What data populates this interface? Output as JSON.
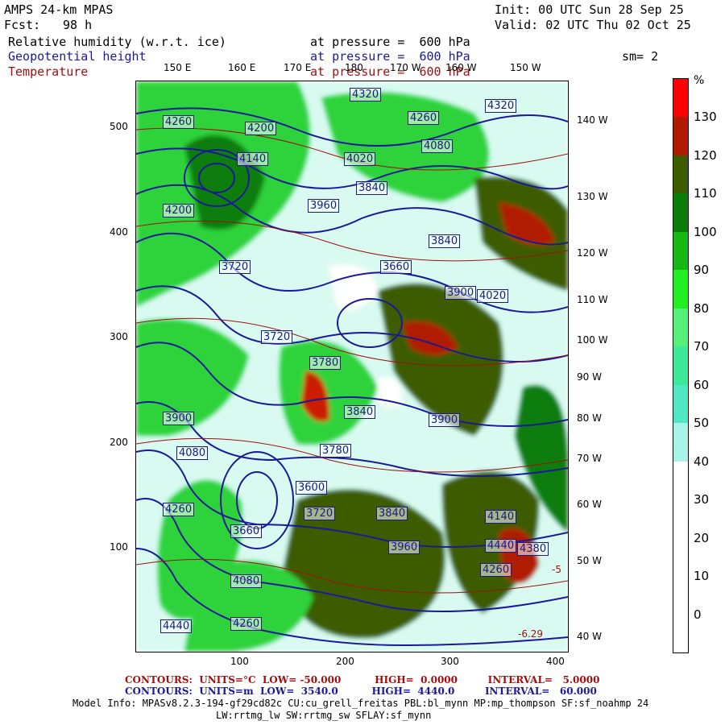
{
  "header": {
    "model": "AMPS 24-km MPAS",
    "fcst_label": "Fcst:",
    "fcst_value": "98 h",
    "init": "Init: 00 UTC Sun 28 Sep 25",
    "valid": "Valid: 02 UTC Thu 02 Oct 25",
    "smooth": "sm= 2"
  },
  "fields": [
    {
      "name": "Relative humidity (w.r.t. ice)",
      "level": "at pressure =  600 hPa",
      "color": "#000000"
    },
    {
      "name": "Geopotential height",
      "level": "at pressure =  600 hPa",
      "color": "#1a1a99"
    },
    {
      "name": "Temperature",
      "level": "at pressure =  600 hPa",
      "color": "#a01010"
    }
  ],
  "top_longitudes": [
    "150 E",
    "160 E",
    "170 E",
    "180",
    "170 W",
    "160 W",
    "150 W"
  ],
  "right_longitudes": [
    "140 W",
    "130 W",
    "120 W",
    "110 W",
    "100 W",
    "90 W",
    "80 W",
    "70 W",
    "60 W",
    "50 W",
    "40 W"
  ],
  "y_axis_ticks": [
    "500",
    "400",
    "300",
    "200",
    "100"
  ],
  "x_axis_ticks": [
    "100",
    "200",
    "300",
    "400"
  ],
  "colorbar": {
    "unit": "%",
    "labels": [
      "130",
      "120",
      "110",
      "100",
      "90",
      "80",
      "70",
      "60",
      "50",
      "40",
      "30",
      "20",
      "10",
      "0"
    ],
    "colors": [
      "#ff0000",
      "#b01a00",
      "#3d5c00",
      "#0a7d0a",
      "#16b816",
      "#22ee22",
      "#55f07a",
      "#3ee89a",
      "#50e8c4",
      "#a8f4e8",
      "#ffffff",
      "#ffffff",
      "#ffffff",
      "#ffffff",
      "#ffffff"
    ]
  },
  "contour_labels": [
    "4320",
    "4320",
    "4260",
    "4260",
    "4140",
    "4200",
    "4080",
    "4020",
    "3960",
    "3840",
    "3780",
    "3720",
    "3900",
    "4020",
    "3660",
    "3720",
    "3840",
    "3900",
    "4080",
    "4200",
    "4260",
    "4440",
    "4260",
    "4140",
    "4380",
    "4440",
    "4080",
    "4260",
    "3840",
    "3960",
    "3660",
    "3720",
    "3600",
    "3780",
    "3840",
    "3900"
  ],
  "footer": {
    "line1": "CONTOURS:  UNITS=°C  LOW= -50.000          HIGH=  0.0000         INTERVAL=   5.0000",
    "line2": "CONTOURS:  UNITS=m  LOW=  3540.0          HIGH=  4440.0         INTERVAL=   60.000",
    "line3": "Model Info: MPASv8.2.3-194-gf29cd82c CU:cu_grell_freitas PBL:bl_mynn MP:mp_thompson SF:sf_noahmp 24",
    "line4": "LW:rrtmg_lw SW:rrtmg_sw SFLAY:sf_mynn"
  },
  "corner_values": [
    "-6.29",
    "-5"
  ]
}
